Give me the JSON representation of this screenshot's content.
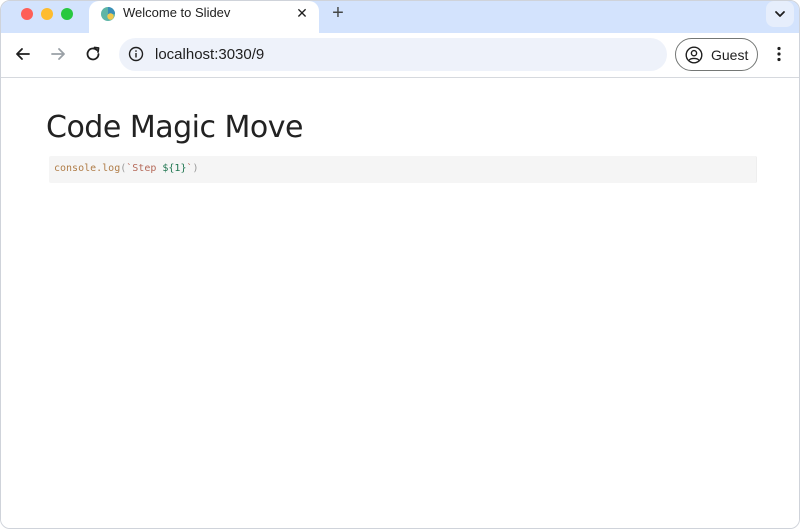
{
  "browser": {
    "tab": {
      "title": "Welcome to Slidev",
      "close_icon": "close-icon",
      "favicon": "slidev-logo-icon"
    },
    "new_tab_label": "+",
    "address_bar": {
      "url": "localhost:3030/9"
    },
    "profile": {
      "label": "Guest"
    },
    "colors": {
      "tabstrip": "#d3e3fd",
      "omnibox": "#eef2fa",
      "close": "#fe5f57",
      "minimize": "#febc2e",
      "zoom": "#28c840"
    }
  },
  "slide": {
    "title": "Code Magic Move",
    "code": {
      "fn": "console.log",
      "open_paren": "(",
      "str_open": "`Step ",
      "interp": "${1}",
      "str_close": "`",
      "close_paren": ")"
    }
  }
}
